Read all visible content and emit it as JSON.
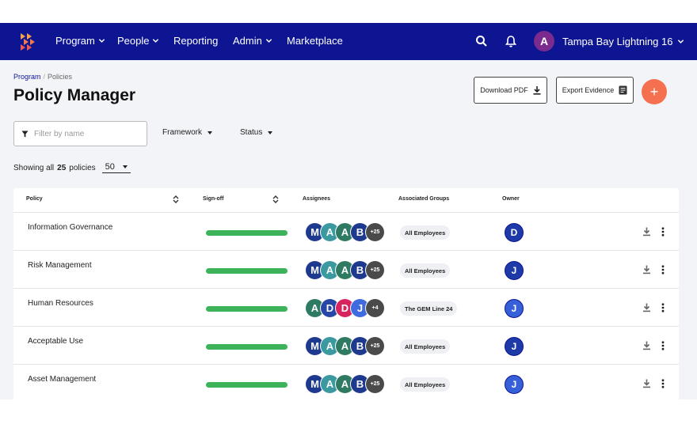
{
  "nav": {
    "items": [
      {
        "label": "Program",
        "has_menu": true
      },
      {
        "label": "People",
        "has_menu": true
      },
      {
        "label": "Reporting",
        "has_menu": false
      },
      {
        "label": "Admin",
        "has_menu": true
      },
      {
        "label": "Marketplace",
        "has_menu": false
      }
    ],
    "user_initial": "A",
    "org_name": "Tampa Bay Lightning 16"
  },
  "breadcrumb": {
    "parent": "Program",
    "separator": "/",
    "current": "Policies"
  },
  "page_title": "Policy Manager",
  "actions": {
    "download_pdf": "Download PDF",
    "export_evidence": "Export Evidence",
    "add": "+"
  },
  "filters": {
    "search_placeholder": "Filter by name",
    "framework": "Framework",
    "status": "Status"
  },
  "summary": {
    "prefix": "Showing all",
    "count": "25",
    "suffix": "policies",
    "page_size": "50"
  },
  "table": {
    "headers": {
      "policy": "Policy",
      "signoff": "Sign-off",
      "assignees": "Assignees",
      "groups": "Associated Groups",
      "owner": "Owner"
    },
    "rows": [
      {
        "name": "Information Governance",
        "signoff_fraction": 1.0,
        "assignees": [
          {
            "initial": "M",
            "color": "#1d3a8f"
          },
          {
            "initial": "A",
            "color": "#3a9aa0"
          },
          {
            "initial": "A",
            "color": "#2f7a63"
          },
          {
            "initial": "B",
            "color": "#1d3a8f"
          }
        ],
        "more": "+25",
        "group": "All Employees",
        "owner": {
          "initial": "D",
          "color": "#1d3aa8"
        }
      },
      {
        "name": "Risk Management",
        "signoff_fraction": 1.0,
        "assignees": [
          {
            "initial": "M",
            "color": "#1d3a8f"
          },
          {
            "initial": "A",
            "color": "#3a9aa0"
          },
          {
            "initial": "A",
            "color": "#2f7a63"
          },
          {
            "initial": "B",
            "color": "#1d3a8f"
          }
        ],
        "more": "+25",
        "group": "All Employees",
        "owner": {
          "initial": "J",
          "color": "#1d3aa8"
        }
      },
      {
        "name": "Human Resources",
        "signoff_fraction": 1.0,
        "assignees": [
          {
            "initial": "A",
            "color": "#2f7a63"
          },
          {
            "initial": "D",
            "color": "#2746a8"
          },
          {
            "initial": "D",
            "color": "#d6245f"
          },
          {
            "initial": "J",
            "color": "#3f6ae0"
          }
        ],
        "more": "+4",
        "group": "The GEM Line 24",
        "owner": {
          "initial": "J",
          "color": "#3560d8"
        }
      },
      {
        "name": "Acceptable Use",
        "signoff_fraction": 1.0,
        "assignees": [
          {
            "initial": "M",
            "color": "#1d3a8f"
          },
          {
            "initial": "A",
            "color": "#3a9aa0"
          },
          {
            "initial": "A",
            "color": "#2f7a63"
          },
          {
            "initial": "B",
            "color": "#1d3a8f"
          }
        ],
        "more": "+25",
        "group": "All Employees",
        "owner": {
          "initial": "J",
          "color": "#1d3aa8"
        }
      },
      {
        "name": "Asset Management",
        "signoff_fraction": 1.0,
        "assignees": [
          {
            "initial": "M",
            "color": "#1d3a8f"
          },
          {
            "initial": "A",
            "color": "#3a9aa0"
          },
          {
            "initial": "A",
            "color": "#2f7a63"
          },
          {
            "initial": "B",
            "color": "#1d3a8f"
          }
        ],
        "more": "+25",
        "group": "All Employees",
        "owner": {
          "initial": "J",
          "color": "#3560d8"
        }
      }
    ]
  },
  "colors": {
    "nav_bg": "#0d1593",
    "accent_add": "#f4704e",
    "signoff_bar": "#3db35a",
    "user_avatar": "#7b2a8e"
  },
  "icons": {
    "logo": "hexagon-logo-icon",
    "search": "search-icon",
    "notifications": "bell-icon",
    "download": "download-icon",
    "export": "document-icon",
    "filter": "filter-icon",
    "sort": "sort-icon",
    "row_menu": "kebab-menu-icon"
  }
}
